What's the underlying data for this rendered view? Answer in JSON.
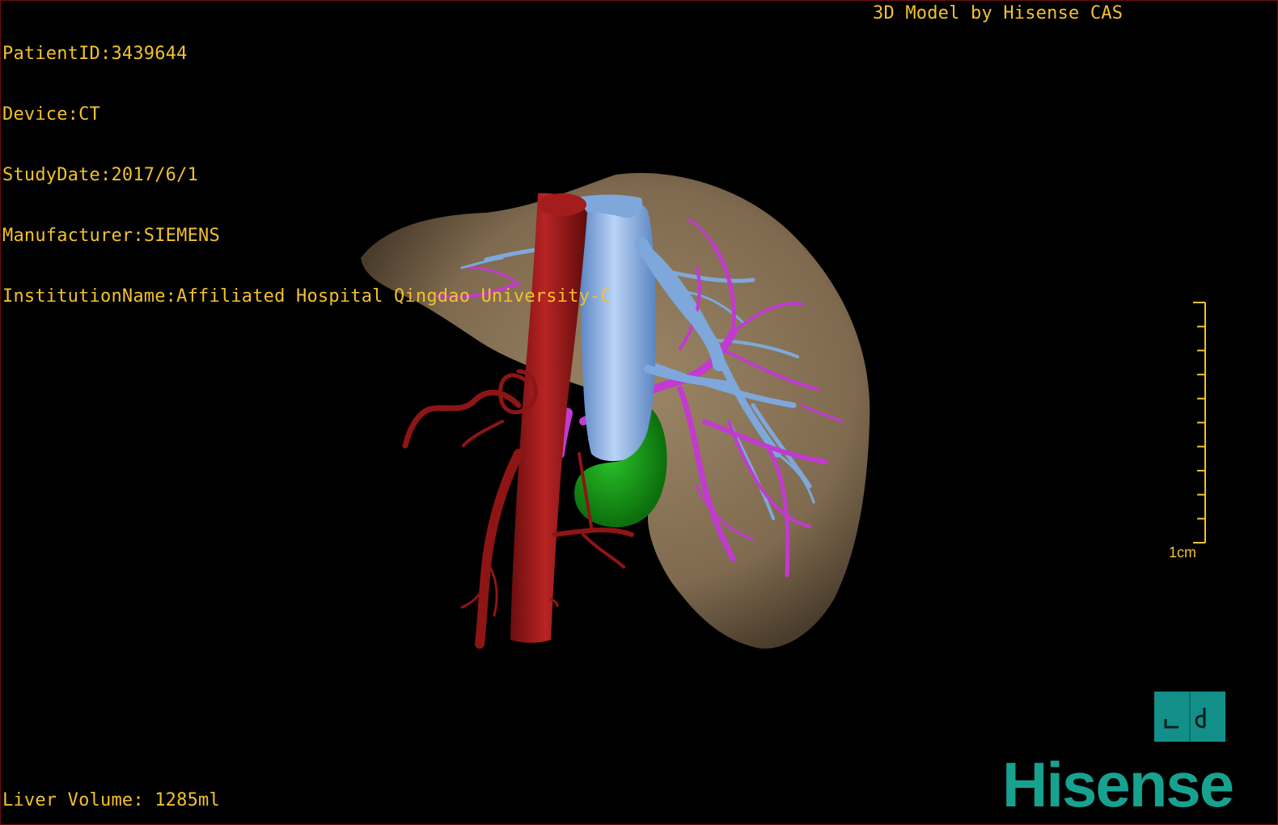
{
  "patient_info": {
    "lines": [
      "PatientID:3439644",
      "Device:CT",
      "StudyDate:2017/6/1",
      "Manufacturer:SIEMENS",
      "InstitutionName:Affiliated Hospital Qingdao University-C"
    ]
  },
  "header": {
    "model_title": "3D Model by Hisense CAS"
  },
  "scale_bar": {
    "label": "1cm",
    "tick_count": 10,
    "color": "#f2c12e"
  },
  "footer": {
    "liver_volume": "Liver Volume: 1285ml"
  },
  "brand": {
    "name": "Hisense",
    "color": "#17a290"
  },
  "model_structures": {
    "liver": {
      "color": "#8a7356"
    },
    "aorta": {
      "color": "#8e1515"
    },
    "inferior_vena_cava": {
      "color": "#8fb4e6"
    },
    "portal_vein": {
      "color": "#c23ad0"
    },
    "hepatic_vein": {
      "color": "#7ea8dc"
    },
    "gallbladder": {
      "color": "#15a015"
    }
  },
  "view_cube": {
    "icon": "orientation-cube-icon",
    "color": "#138f8a"
  }
}
